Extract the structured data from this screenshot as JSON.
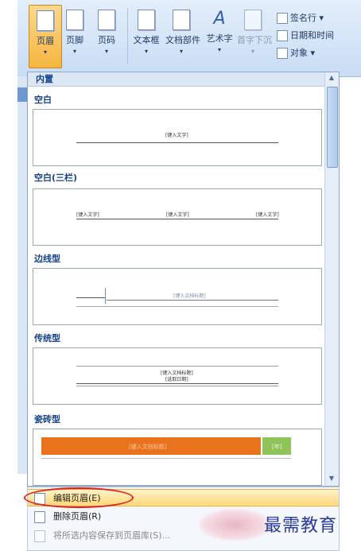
{
  "ribbon": {
    "buttons": [
      {
        "label": "页眉",
        "arrow": "▾"
      },
      {
        "label": "页脚",
        "arrow": "▾"
      },
      {
        "label": "页码",
        "arrow": "▾"
      },
      {
        "label": "文本框",
        "arrow": "▾"
      },
      {
        "label": "文档部件",
        "arrow": "▾"
      },
      {
        "label": "艺术字",
        "arrow": "▾"
      },
      {
        "label": "首字下沉",
        "arrow": "▾"
      }
    ],
    "small": [
      {
        "label": "签名行 ▾"
      },
      {
        "label": "日期和时间"
      },
      {
        "label": "对象 ▾"
      }
    ]
  },
  "panel": {
    "builtin": "内置",
    "sections": [
      {
        "title": "空白",
        "placeholders": [
          "[键入文字]"
        ]
      },
      {
        "title": "空白(三栏)",
        "placeholders": [
          "[键入文字]",
          "[键入文字]",
          "[键入文字]"
        ]
      },
      {
        "title": "边线型",
        "placeholders": [
          "[键入文档标题]"
        ]
      },
      {
        "title": "传统型",
        "placeholders": [
          "[键入文档标题]",
          "[选取日期]"
        ]
      },
      {
        "title": "瓷砖型",
        "placeholders": [
          "[键入文档标题]",
          "[年]"
        ]
      }
    ],
    "tile_colors": {
      "orange": "#e8731c",
      "green": "#8fc45a"
    }
  },
  "menu": {
    "items": [
      {
        "label": "编辑页眉(E)"
      },
      {
        "label": "删除页眉(R)"
      },
      {
        "label": "将所选内容保存到页眉库(S)..."
      }
    ]
  },
  "watermark": "最需教育"
}
